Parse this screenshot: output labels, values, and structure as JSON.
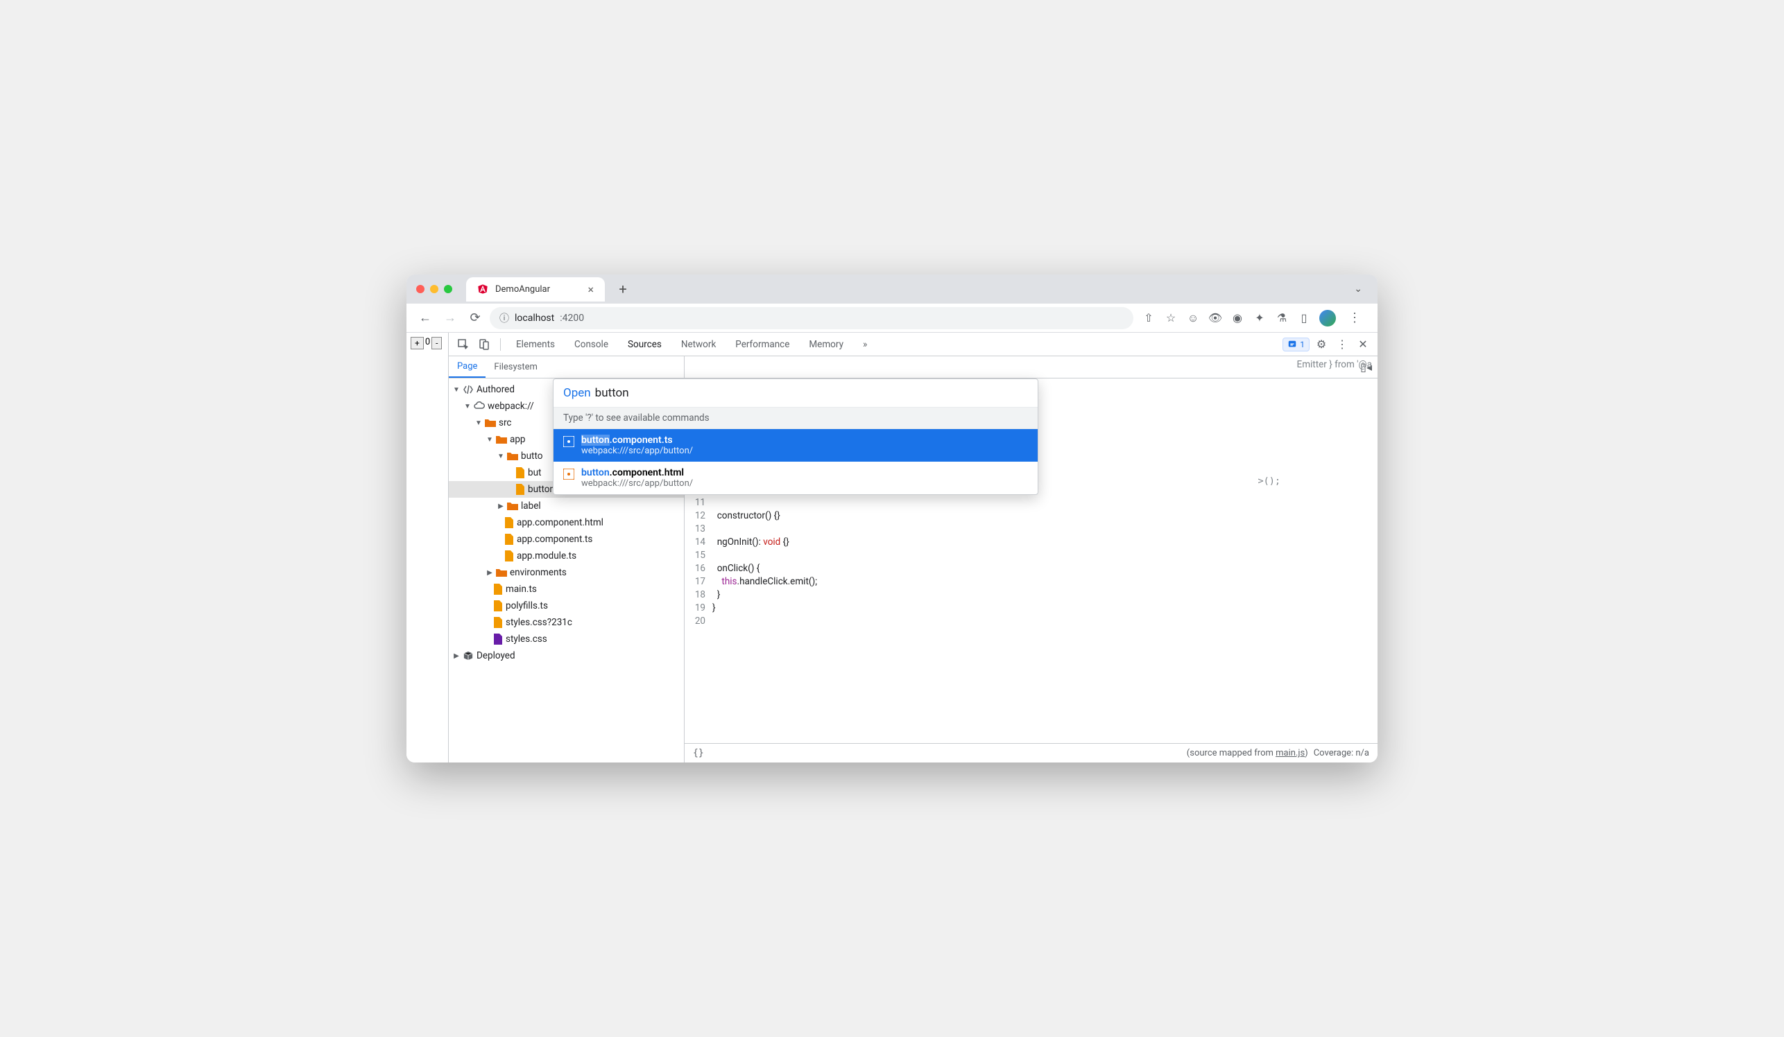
{
  "browser": {
    "tab_title": "DemoAngular",
    "url_host": "localhost",
    "url_port": ":4200"
  },
  "page": {
    "plus": "+",
    "zero": "0",
    "minus": "-"
  },
  "devtools": {
    "tabs": {
      "elements": "Elements",
      "console": "Console",
      "sources": "Sources",
      "network": "Network",
      "performance": "Performance",
      "memory": "Memory"
    },
    "issues_count": "1",
    "sidebar_tabs": {
      "page": "Page",
      "filesystem": "Filesystem"
    }
  },
  "tree": {
    "authored": "Authored",
    "webpack": "webpack://",
    "src": "src",
    "app": "app",
    "button_folder": "butto",
    "button_html": "but",
    "button_ts": "button.component.ts",
    "label_folder": "label",
    "app_html": "app.component.html",
    "app_ts": "app.component.ts",
    "app_module": "app.module.ts",
    "environments": "environments",
    "main_ts": "main.ts",
    "polyfills": "polyfills.ts",
    "styles_q": "styles.css?231c",
    "styles": "styles.css",
    "deployed": "Deployed"
  },
  "palette": {
    "open_label": "Open",
    "query": "button",
    "hint": "Type '?' to see available commands",
    "item1_name_match": "button",
    "item1_name_rest": ".component.ts",
    "item1_path": "webpack:///src/app/button/",
    "item2_name_match": "button",
    "item2_name_rest": ".component.html",
    "item2_path": "webpack:///src/app/button/"
  },
  "code": {
    "visible_top": "Emitter } from '@a",
    "line10_tail": ">();",
    "line11": "11",
    "line12": "12",
    "line12_code_a": "constructor() {}",
    "line13": "13",
    "line14": "14",
    "line14_code_a": "ngOnInit(): ",
    "line14_code_b": "void",
    "line14_code_c": " {}",
    "line15": "15",
    "line16": "16",
    "line16_code": "onClick() {",
    "line17": "17",
    "line17_code_a": "this",
    "line17_code_b": ".handleClick.emit();",
    "line18": "18",
    "line18_code": "}",
    "line19": "19",
    "line19_code": "}",
    "line20": "20"
  },
  "statusbar": {
    "braces": "{}",
    "mapped_prefix": "(source mapped from ",
    "mapped_link": "main.js",
    "mapped_suffix": ")",
    "coverage": "Coverage: n/a"
  }
}
